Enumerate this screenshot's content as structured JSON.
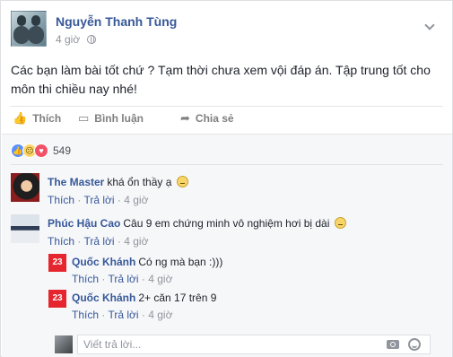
{
  "post": {
    "author": "Nguyễn Thanh Tùng",
    "time": "4 giờ",
    "text": "Các bạn làm bài tốt chứ ? Tạm thời chưa xem vội đáp án. Tập trung tốt cho môn thi chiều nay nhé!"
  },
  "actions": {
    "like": "Thích",
    "comment": "Bình luận",
    "share": "Chia sẻ"
  },
  "reactions": {
    "count": "549"
  },
  "comments": [
    {
      "name": "The Master",
      "text": "khá ổn thầy ạ",
      "like": "Thích",
      "reply": "Trả lời",
      "time": "4 giờ"
    },
    {
      "name": "Phúc Hậu Cao",
      "text": "Câu 9 em chứng minh vô nghiệm hơi bị dài",
      "like": "Thích",
      "reply": "Trả lời",
      "time": "4 giờ"
    }
  ],
  "replies": [
    {
      "avatar_text": "23",
      "name": "Quốc Khánh",
      "text": "Có ng mà bạn :)))",
      "like": "Thích",
      "reply": "Trả lời",
      "time": "4 giờ"
    },
    {
      "avatar_text": "23",
      "name": "Quốc Khánh",
      "text": "2+ căn 17 trên 9",
      "like": "Thích",
      "reply": "Trả lời",
      "time": "4 giờ"
    }
  ],
  "reply_box": {
    "placeholder": "Viết trả lời..."
  },
  "colors": {
    "link": "#365899",
    "meta": "#90949c",
    "background": "#f6f7f9"
  }
}
